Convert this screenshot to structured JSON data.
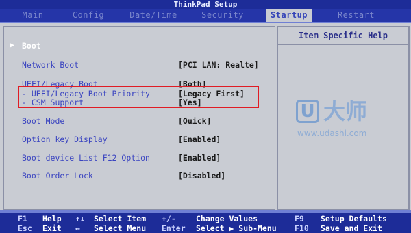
{
  "title": "ThinkPad Setup",
  "tabs": [
    {
      "label": "Main"
    },
    {
      "label": "Config"
    },
    {
      "label": "Date/Time"
    },
    {
      "label": "Security"
    },
    {
      "label": "Startup"
    },
    {
      "label": "Restart"
    }
  ],
  "active_tab": "Startup",
  "help_title": "Item Specific Help",
  "boot": {
    "arrow": "▶",
    "label": "Boot"
  },
  "settings": [
    {
      "label": "Network Boot",
      "value": "[PCI LAN: Realte]"
    },
    {
      "label": "UEFI/Legacy Boot",
      "value": "[Both]"
    },
    {
      "label": "- UEFI/Legacy Boot Priority",
      "value": "[Legacy First]"
    },
    {
      "label": "- CSM Support",
      "value": "[Yes]"
    },
    {
      "label": "Boot Mode",
      "value": "[Quick]"
    },
    {
      "label": "Option key Display",
      "value": "[Enabled]"
    },
    {
      "label": "Boot device List F12 Option",
      "value": "[Enabled]"
    },
    {
      "label": "Boot Order Lock",
      "value": "[Disabled]"
    }
  ],
  "watermark": {
    "logo": "U",
    "text": "大师",
    "url": "www.udashi.com"
  },
  "footer": {
    "f1_key": "F1",
    "f1_desc": "Help",
    "esc_key": "Esc",
    "esc_desc": "Exit",
    "updown_key": "↑↓",
    "updown_desc": "Select Item",
    "leftright_key": "↔",
    "leftright_desc": "Select Menu",
    "plusminus_key": "+/-",
    "plusminus_desc": "Change Values",
    "enter_key": "Enter",
    "enter_desc": "Select ▶ Sub-Menu",
    "f9_key": "F9",
    "f9_desc": "Setup Defaults",
    "f10_key": "F10",
    "f10_desc": "Save and Exit"
  },
  "colors": {
    "header_bg": "#1d2c98",
    "panel_bg": "#c9ccd3",
    "label": "#3a44c0",
    "highlight_border": "#e01c24"
  }
}
